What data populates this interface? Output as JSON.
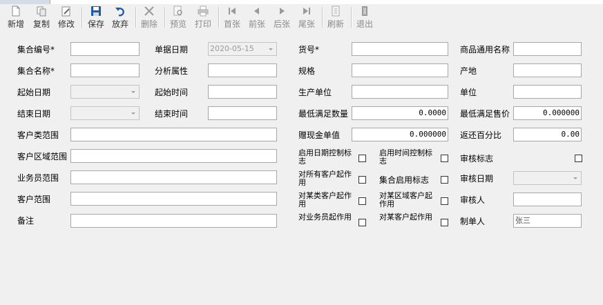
{
  "toolbar": {
    "new": "新增",
    "copy": "复制",
    "edit": "修改",
    "save": "保存",
    "cancel": "放弃",
    "delete": "删除",
    "preview": "预览",
    "print": "打印",
    "first": "首张",
    "prev": "前张",
    "next": "后张",
    "last": "尾张",
    "refresh": "刷新",
    "exit": "退出"
  },
  "form": {
    "set_code_label": "集合编号*",
    "set_code_value": "",
    "doc_date_label": "单据日期",
    "doc_date_value": "2020-05-15",
    "item_no_label": "货号*",
    "item_no_value": "",
    "generic_name_label": "商品通用名称",
    "generic_name_value": "",
    "set_name_label": "集合名称*",
    "set_name_value": "",
    "analysis_attr_label": "分析属性",
    "analysis_attr_value": "",
    "spec_label": "规格",
    "spec_value": "",
    "origin_label": "产地",
    "origin_value": "",
    "start_date_label": "起始日期",
    "start_date_value": "",
    "start_time_label": "起始时间",
    "start_time_value": "",
    "manufacturer_label": "生产单位",
    "manufacturer_value": "",
    "unit_label": "单位",
    "unit_value": "",
    "end_date_label": "结束日期",
    "end_date_value": "",
    "end_time_label": "结束时间",
    "end_time_value": "",
    "min_qty_label": "最低满足数量",
    "min_qty_value": "0.0000",
    "min_price_label": "最低满足售价",
    "min_price_value": "0.000000",
    "customer_class_label": "客户类范围",
    "customer_class_value": "",
    "gift_cash_label": "赠现金单值",
    "gift_cash_value": "0.000000",
    "rebate_label": "返还百分比",
    "rebate_value": "0.00",
    "customer_region_label": "客户区域范围",
    "customer_region_value": "",
    "date_ctrl_label": "启用日期控制标志",
    "time_ctrl_label": "启用时间控制标志",
    "audit_flag_label": "审核标志",
    "salesman_label": "业务员范围",
    "salesman_value": "",
    "all_customers_label": "对所有客户起作用",
    "set_enable_label": "集合启用标志",
    "audit_date_label": "审核日期",
    "audit_date_value": "",
    "customer_label": "客户范围",
    "customer_value": "",
    "class_customers_label": "对某类客户起作用",
    "region_customers_label": "对某区域客户起作用",
    "auditor_label": "审核人",
    "auditor_value": "",
    "remark_label": "备注",
    "remark_value": "",
    "salesman_effect_label": "对业务员起作用",
    "some_customer_label": "对某客户起作用",
    "maker_label": "制单人",
    "maker_value": "张三"
  }
}
